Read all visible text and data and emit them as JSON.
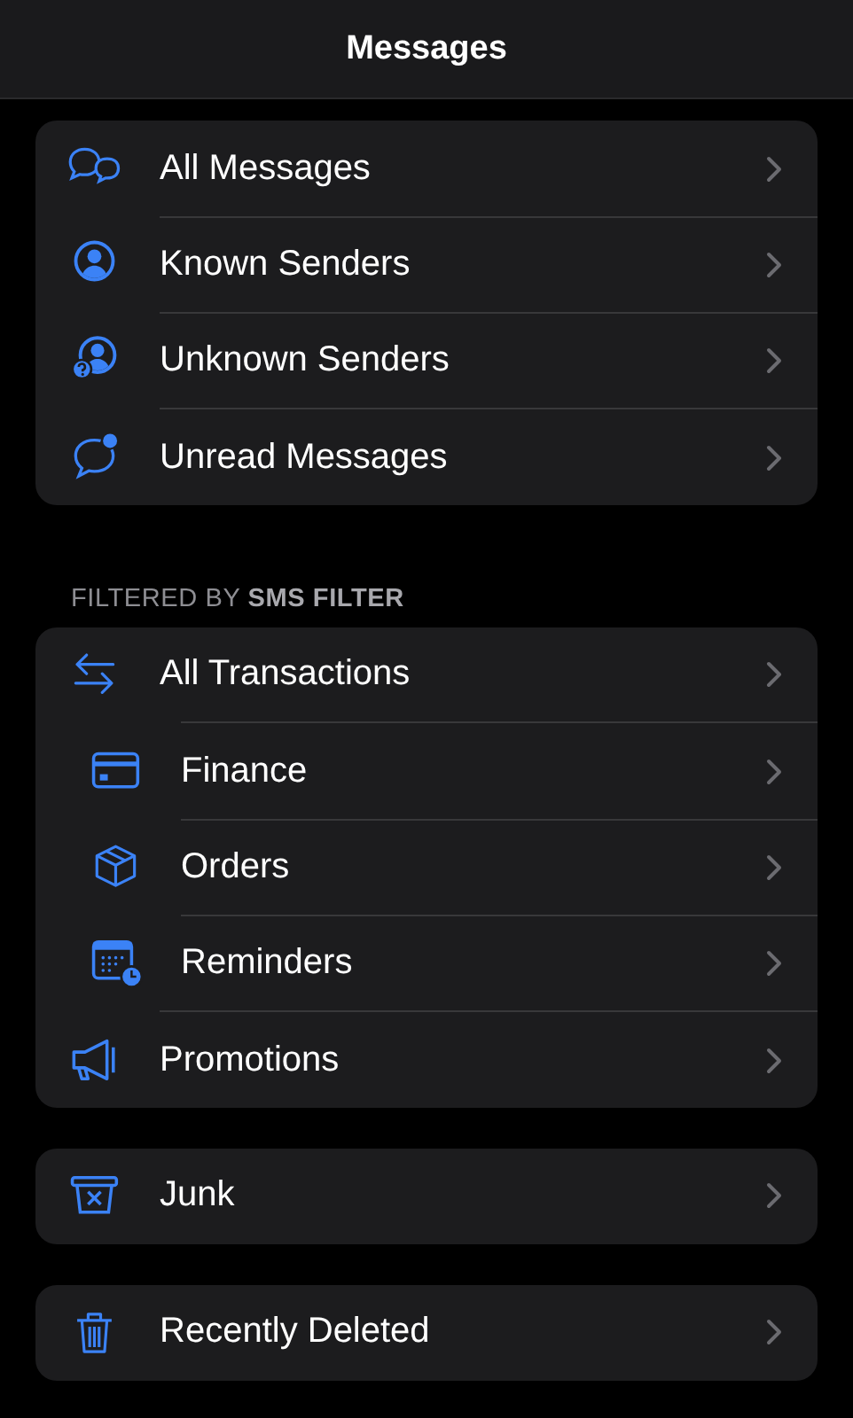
{
  "title": "Messages",
  "sections": [
    {
      "items": [
        {
          "kind": "messages",
          "label": "All Messages",
          "indented": false
        },
        {
          "kind": "person",
          "label": "Known Senders",
          "indented": false
        },
        {
          "kind": "person-question",
          "label": "Unknown Senders",
          "indented": false
        },
        {
          "kind": "unread",
          "label": "Unread Messages",
          "indented": false
        }
      ]
    },
    {
      "header": "FILTERED BY **SMS FILTER**",
      "items": [
        {
          "kind": "transfer",
          "label": "All Transactions",
          "indented": false
        },
        {
          "kind": "card",
          "label": "Finance",
          "indented": true
        },
        {
          "kind": "box",
          "label": "Orders",
          "indented": true
        },
        {
          "kind": "calendar",
          "label": "Reminders",
          "indented": true
        },
        {
          "kind": "megaphone",
          "label": "Promotions",
          "indented": false
        }
      ]
    },
    {
      "items": [
        {
          "kind": "junk",
          "label": "Junk",
          "indented": false
        }
      ]
    },
    {
      "items": [
        {
          "kind": "trash",
          "label": "Recently Deleted",
          "indented": false
        }
      ]
    }
  ]
}
